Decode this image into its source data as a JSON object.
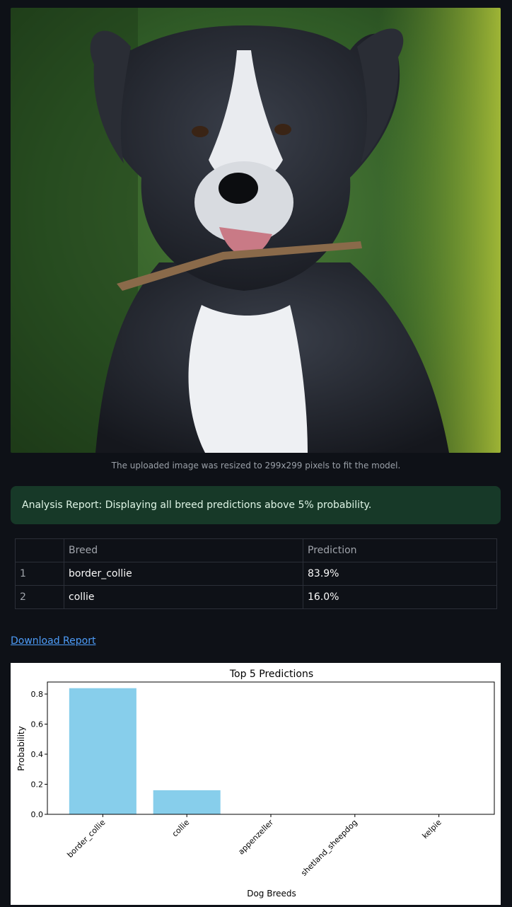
{
  "image": {
    "caption": "The uploaded image was resized to 299x299 pixels to fit the model."
  },
  "alert": {
    "text": "Analysis Report: Displaying all breed predictions above 5% probability.",
    "color": "#173928"
  },
  "table": {
    "columns": [
      "",
      "Breed",
      "Prediction"
    ],
    "rows": [
      {
        "index": "1",
        "breed": "border_collie",
        "prediction": "83.9%"
      },
      {
        "index": "2",
        "breed": "collie",
        "prediction": "16.0%"
      }
    ]
  },
  "download": {
    "label": "Download Report",
    "color": "#4d9cf8"
  },
  "chart_data": {
    "type": "bar",
    "title": "Top 5 Predictions",
    "xlabel": "Dog Breeds",
    "ylabel": "Probability",
    "categories": [
      "border_collie",
      "collie",
      "appenzeller",
      "shetland_sheepdog",
      "kelpie"
    ],
    "values": [
      0.839,
      0.16,
      0.0,
      0.0,
      0.0
    ],
    "ylim": [
      0,
      0.88
    ],
    "yticks": [
      "0.0",
      "0.2",
      "0.4",
      "0.6",
      "0.8"
    ],
    "ytick_values": [
      0,
      0.2,
      0.4,
      0.6,
      0.8
    ],
    "bar_color": "#87ceeb",
    "grid": false
  }
}
